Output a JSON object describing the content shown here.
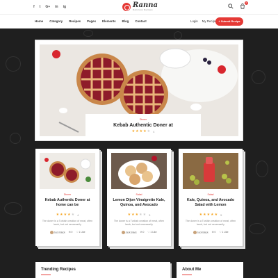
{
  "header": {
    "social": [
      "f",
      "t",
      "G+",
      "in",
      "ig"
    ],
    "logo_name": "Ranna",
    "logo_tag": "Delicious Recipes",
    "cart_count": "0"
  },
  "nav": {
    "items": [
      "Home",
      "Category",
      "Recipes",
      "Pages",
      "Elements",
      "Blog",
      "Contact"
    ],
    "login": "Login",
    "my_recipe": "My Recipe",
    "submit": "+ Submit Recipe"
  },
  "hero": {
    "category": "Dinner",
    "title": "Kebab Authentic Doner at",
    "stars": 4,
    "rating": "4"
  },
  "cards": [
    {
      "category": "Dinner",
      "title": "Kebab Authentic Doner at home can be",
      "stars": 4,
      "rating": "4",
      "excerpt": "The doner is a Turkish creation of meat, often lamb, but not necessarily",
      "author": "Jack Black",
      "comments": "0",
      "likes": "1 Like"
    },
    {
      "category": "Salad",
      "title": "Lemon Dijon Vinaigrette Kale, Quinoa, and Avocado",
      "stars": 3,
      "rating": "3",
      "excerpt": "The doner is a Turkish creation of meat, often lamb, but not necessarily",
      "author": "Jack Black",
      "comments": "0",
      "likes": "1 Like"
    },
    {
      "category": "Salad",
      "title": "Kale, Quinoa, and Avocado Salad with Lemon",
      "stars": 5,
      "rating": "5",
      "excerpt": "The doner is a Turkish creation of meat, often lamb, but not necessarily",
      "author": "Jack Black",
      "comments": "0",
      "likes": "1 Like"
    }
  ],
  "sections": {
    "trending": "Trending Recipes",
    "about": "About Me"
  },
  "colors": {
    "accent": "#e53935",
    "star": "#f5a623",
    "background": "#1f1f1f"
  }
}
